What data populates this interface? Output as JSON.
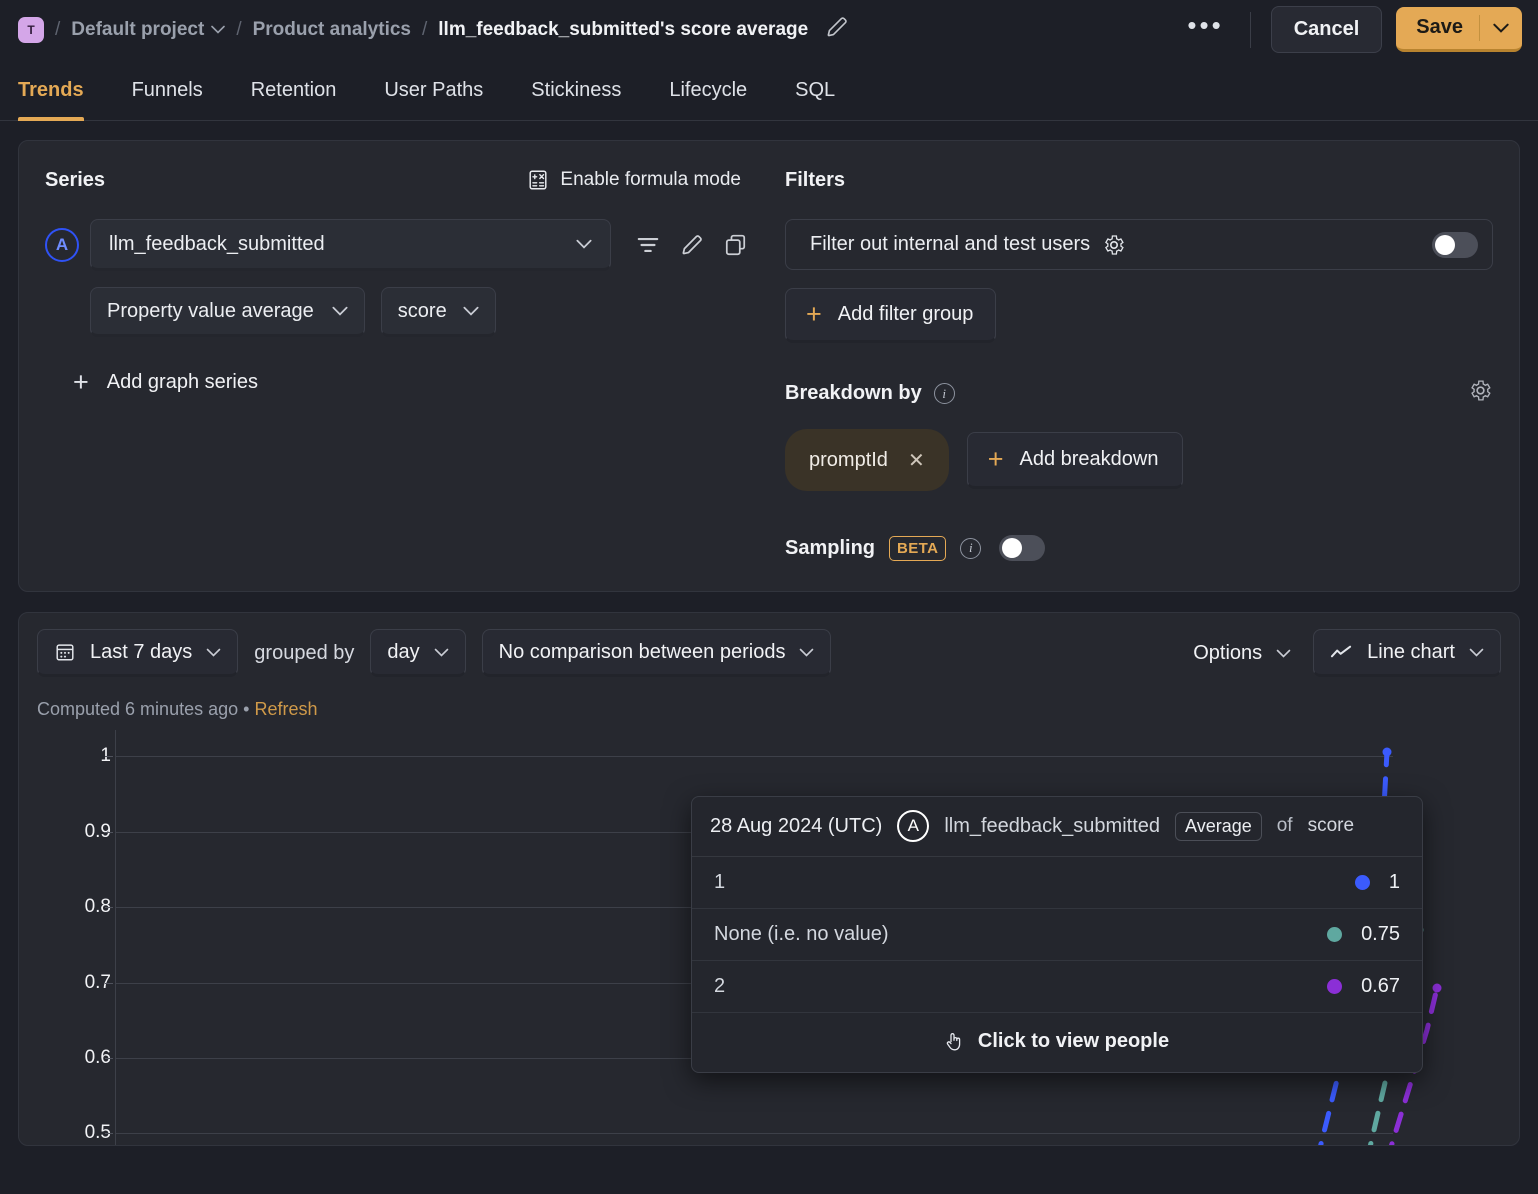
{
  "breadcrumb": {
    "project_initial": "T",
    "project": "Default project",
    "section": "Product analytics",
    "current": "llm_feedback_submitted's score average",
    "sep": "/"
  },
  "topbar": {
    "more_label": "•••",
    "cancel_label": "Cancel",
    "save_label": "Save"
  },
  "tabs": [
    {
      "label": "Trends",
      "active": true
    },
    {
      "label": "Funnels",
      "active": false
    },
    {
      "label": "Retention",
      "active": false
    },
    {
      "label": "User Paths",
      "active": false
    },
    {
      "label": "Stickiness",
      "active": false
    },
    {
      "label": "Lifecycle",
      "active": false
    },
    {
      "label": "SQL",
      "active": false
    }
  ],
  "series": {
    "title": "Series",
    "formula_label": "Enable formula mode",
    "letter": "A",
    "event": "llm_feedback_submitted",
    "aggregation": "Property value average",
    "property": "score",
    "add_series_label": "Add graph series"
  },
  "filters": {
    "title": "Filters",
    "internal_users_label": "Filter out internal and test users",
    "internal_users_enabled": false,
    "add_filter_group_label": "Add filter group"
  },
  "breakdown": {
    "title": "Breakdown by",
    "chips": [
      "promptId"
    ],
    "add_label": "Add breakdown"
  },
  "sampling": {
    "title": "Sampling",
    "beta_label": "BETA",
    "enabled": false
  },
  "chart_controls": {
    "date_range": "Last 7 days",
    "grouped_by_label": "grouped by",
    "interval": "day",
    "comparison": "No comparison between periods",
    "options_label": "Options",
    "chart_type": "Line chart"
  },
  "status": {
    "computed": "Computed 6 minutes ago",
    "separator": "•",
    "refresh": "Refresh"
  },
  "tooltip": {
    "date": "28 Aug 2024 (UTC)",
    "letter": "A",
    "event": "llm_feedback_submitted",
    "aggregation_pill": "Average",
    "of_label": "of",
    "property": "score",
    "rows": [
      {
        "label": "1",
        "value": "1",
        "color": "#3b5bfd"
      },
      {
        "label": "None (i.e. no value)",
        "value": "0.75",
        "color": "#5fa8a0"
      },
      {
        "label": "2",
        "value": "0.67",
        "color": "#8b2fd6"
      }
    ],
    "footer": "Click to view people"
  },
  "chart_data": {
    "type": "line",
    "title": "llm_feedback_submitted's score average",
    "xlabel": "",
    "ylabel": "",
    "ylim": [
      0.5,
      1
    ],
    "ytick_labels": [
      "1",
      "0.9",
      "0.8",
      "0.7",
      "0.6",
      "0.5"
    ],
    "yticks": [
      1,
      0.9,
      0.8,
      0.7,
      0.6,
      0.5
    ],
    "grid": true,
    "legend": "hidden",
    "line_style": "dashed",
    "x": [
      "28 Aug 2024"
    ],
    "series": [
      {
        "name": "1",
        "color": "#3b5bfd",
        "values": [
          1
        ]
      },
      {
        "name": "None (i.e. no value)",
        "color": "#5fa8a0",
        "values": [
          0.75
        ]
      },
      {
        "name": "2",
        "color": "#8b2fd6",
        "values": [
          0.67
        ]
      }
    ]
  },
  "theme": {
    "accent": "#e4a955",
    "page_bg": "#1d1f27",
    "panel_bg": "#26282f"
  }
}
